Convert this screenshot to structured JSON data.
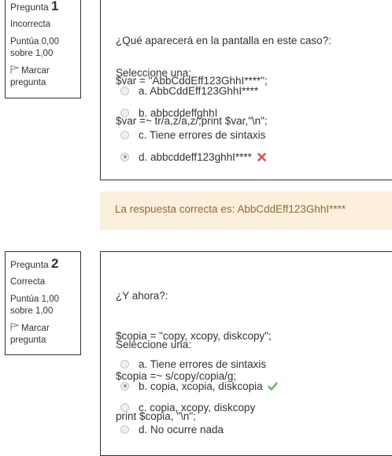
{
  "questions": [
    {
      "number_label": "Pregunta",
      "number": "1",
      "state": "Incorrecta",
      "grade": "Puntúa 0,00 sobre 1,00",
      "flag_label": "Marcar pregunta",
      "text_lines": [
        "¿Qué aparecerá en la pantalla en este caso?:",
        "$var = \"AbbCddEff123GhhI****\";",
        "$var =~ tr/a,z/a,z/;print $var,\"\\n\";"
      ],
      "prompt": "Seleccione una:",
      "options": [
        {
          "label": "a. AbbCddEff123GhhI****",
          "selected": false,
          "mark": ""
        },
        {
          "label": "b. abbcddeffghhI",
          "selected": false,
          "mark": ""
        },
        {
          "label": "c. Tiene errores de sintaxis",
          "selected": false,
          "mark": ""
        },
        {
          "label": "d. abbcddeff123ghhI****",
          "selected": true,
          "mark": "incorrect"
        }
      ],
      "feedback": "La respuesta correcta es: AbbCddEff123GhhI****"
    },
    {
      "number_label": "Pregunta",
      "number": "2",
      "state": "Correcta",
      "grade": "Puntúa 1,00 sobre 1,00",
      "flag_label": "Marcar pregunta",
      "text_lines": [
        "¿Y ahora?:",
        "$copia = \"copy, xcopy, diskcopy\";",
        "$copia =~ s/copy/copia/g;",
        "print $copia, \"\\n\";"
      ],
      "prompt": "Seleccione una:",
      "options": [
        {
          "label": "a. Tiene errores de sintaxis",
          "selected": false,
          "mark": ""
        },
        {
          "label": "b. copia, xcopia, diskcopia",
          "selected": true,
          "mark": "correct"
        },
        {
          "label": "c. copia, xcopy, diskcopy",
          "selected": false,
          "mark": ""
        },
        {
          "label": "d. No ocurre nada",
          "selected": false,
          "mark": ""
        }
      ]
    }
  ],
  "colors": {
    "incorrect": "#d9534f",
    "correct": "#5cb85c",
    "feedback_bg": "#fcefdc",
    "feedback_text": "#8a6d3b"
  },
  "icons": [
    "flag-icon",
    "cross-icon",
    "check-icon",
    "radio-icon"
  ]
}
